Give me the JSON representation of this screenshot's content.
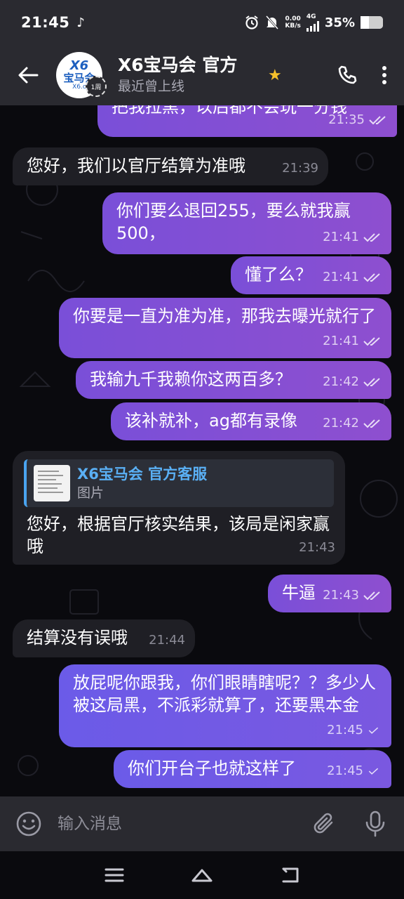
{
  "status": {
    "time": "21:45",
    "net_speed_value": "0.00",
    "net_speed_unit": "KB/s",
    "network": "4G",
    "battery": "35%",
    "battery_level": 0.35
  },
  "header": {
    "title": "X6宝马会 官方",
    "subtitle": "最近曾上线",
    "avatar_logo": "X6",
    "avatar_logo_cn": "宝马会",
    "avatar_url": "X6.c",
    "avatar_badge": "1周"
  },
  "messages": [
    {
      "dir": "out",
      "text": "把我拉黑，以后都不会玩一分钱",
      "time": "21:35",
      "read": true
    },
    {
      "dir": "in",
      "text": "您好，我们以官厅结算为准哦",
      "time": "21:39"
    },
    {
      "dir": "out",
      "text": "你们要么退回255，要么就我赢500，",
      "time": "21:41",
      "read": true
    },
    {
      "dir": "out",
      "text": "懂了么？",
      "time": "21:41",
      "read": true
    },
    {
      "dir": "out",
      "text": "你要是一直为准为准，那我去曝光就行了",
      "time": "21:41",
      "read": true
    },
    {
      "dir": "out",
      "text": "我输九千我赖你这两百多？",
      "time": "21:42",
      "read": true
    },
    {
      "dir": "out",
      "text": "该补就补，ag都有录像",
      "time": "21:42",
      "read": true
    },
    {
      "dir": "in",
      "reply_name": "X6宝马会 官方客服",
      "reply_sub": "图片",
      "text": "您好，根据官厅核实结果，该局是闲家赢哦",
      "time": "21:43"
    },
    {
      "dir": "out",
      "text": "牛逼",
      "time": "21:43",
      "read": true
    },
    {
      "dir": "in",
      "text": "结算没有误哦",
      "time": "21:44"
    },
    {
      "dir": "out",
      "text": "放屁呢你跟我，你们眼睛瞎呢？？多少人被这局黑，不派彩就算了，还要黑本金",
      "time": "21:45",
      "read": false
    },
    {
      "dir": "out",
      "text": "你们开台子也就这样了",
      "time": "21:45",
      "read": false
    }
  ],
  "input": {
    "placeholder": "输入消息"
  },
  "colors": {
    "outgoing_bubble": "#8150d6",
    "incoming_bubble": "#1f1f25",
    "header_bg": "#2a2a30",
    "reply_accent": "#4aa4f0",
    "star": "#f6c12b"
  }
}
